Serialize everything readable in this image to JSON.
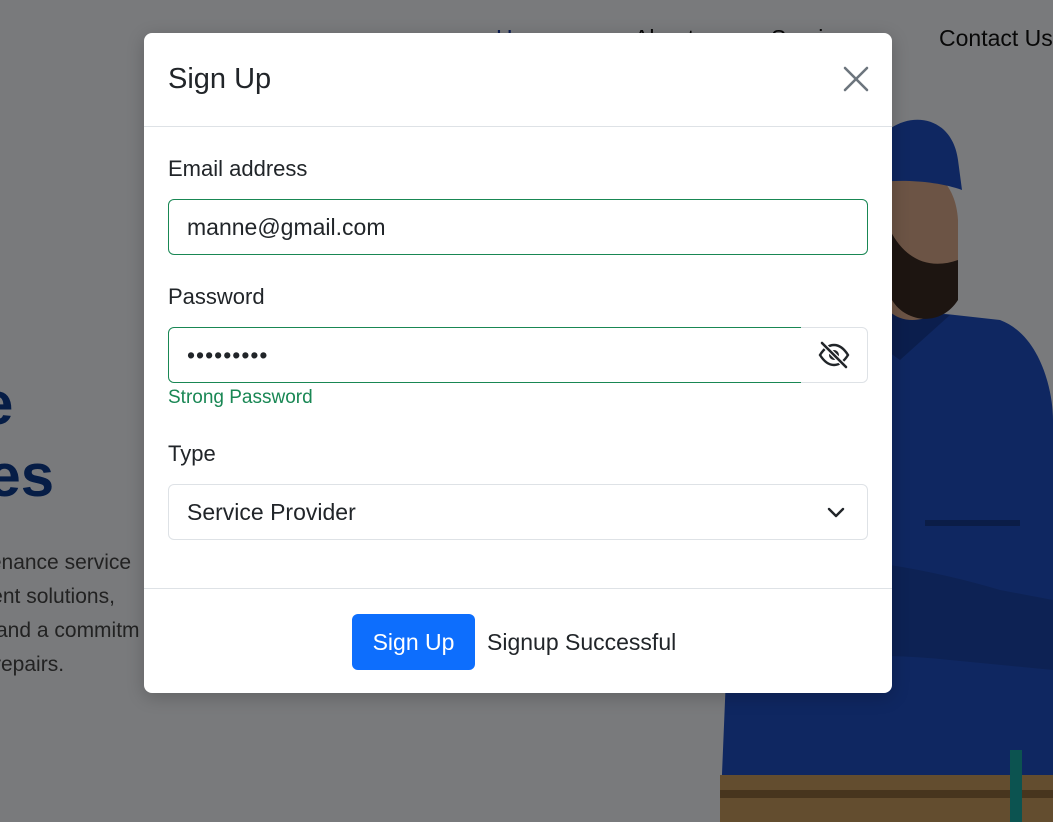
{
  "background": {
    "nav": {
      "home": "Home",
      "about": "About",
      "services": "Services",
      "contact": "Contact Us"
    },
    "hero": {
      "title_line1": "e",
      "title_line2": "ces",
      "text_line1": "tenance service",
      "text_line2": "cient solutions,",
      "text_line3": "and a commitm",
      "text_line4": "repairs."
    }
  },
  "modal": {
    "title": "Sign Up",
    "close_icon": "close-icon",
    "email": {
      "label": "Email address",
      "value": "manne@gmail.com"
    },
    "password": {
      "label": "Password",
      "value": "•••••••••",
      "toggle_icon": "eye-slash-icon",
      "strength_text": "Strong Password"
    },
    "type": {
      "label": "Type",
      "selected": "Service Provider",
      "chevron_icon": "chevron-down-icon"
    },
    "footer": {
      "submit_label": "Sign Up",
      "status_text": "Signup Successful"
    }
  },
  "colors": {
    "primary": "#0d6efd",
    "success": "#198754",
    "hero_title": "#0d3a8c",
    "worker_uniform": "#1f4fc2"
  }
}
